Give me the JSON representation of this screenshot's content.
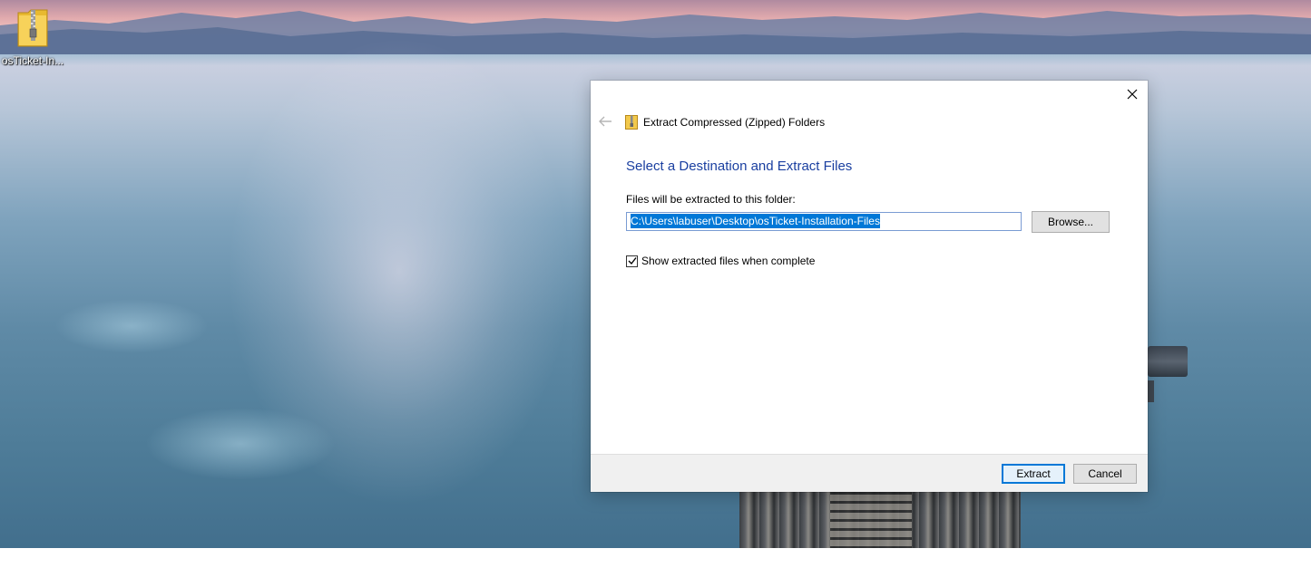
{
  "desktop": {
    "icon": {
      "label": "osTicket-In...",
      "icon": "zip-folder-icon"
    }
  },
  "dialog": {
    "window_title": "Extract Compressed (Zipped) Folders",
    "heading": "Select a Destination and Extract Files",
    "field_label": "Files will be extracted to this folder:",
    "destination_path": "C:\\Users\\labuser\\Desktop\\osTicket-Installation-Files",
    "browse_label": "Browse...",
    "checkbox": {
      "label": "Show extracted files when complete",
      "checked": true
    },
    "extract_label": "Extract",
    "cancel_label": "Cancel"
  },
  "colors": {
    "heading": "#1a3fa0",
    "selection": "#0078d7",
    "default_button_border": "#0078d7"
  }
}
